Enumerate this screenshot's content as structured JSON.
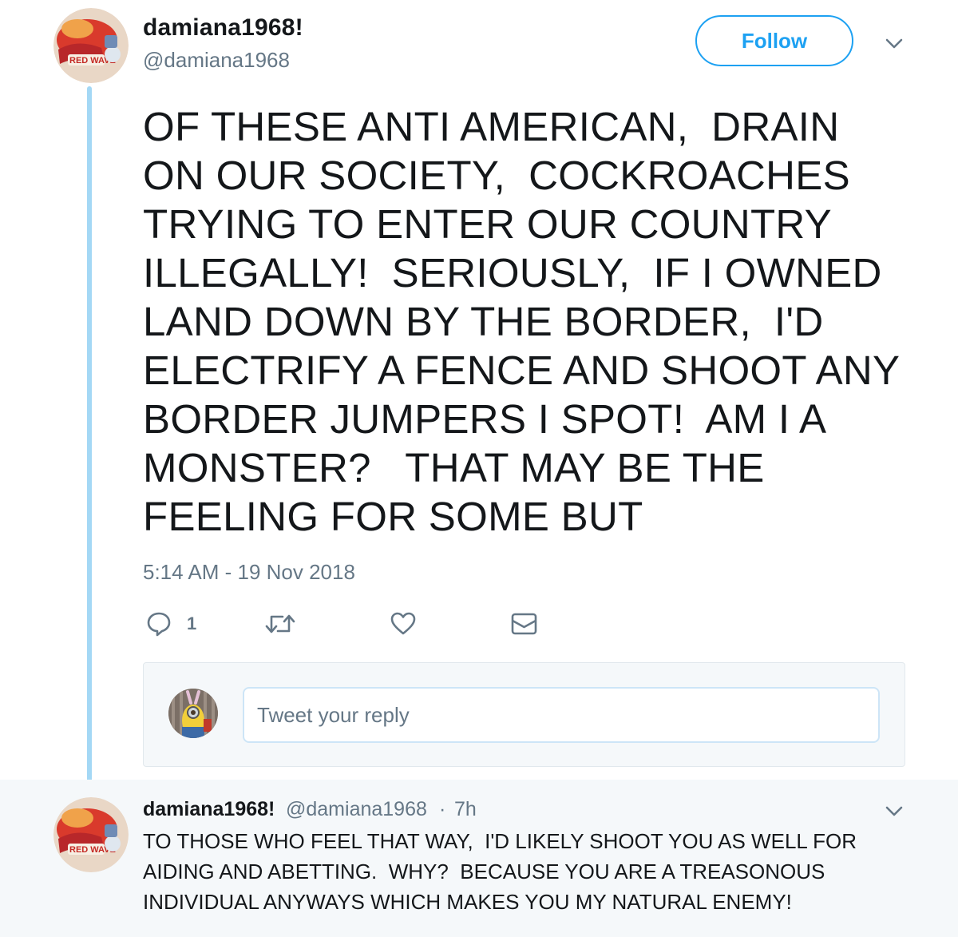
{
  "tweet": {
    "author": {
      "display_name": "damiana1968!",
      "handle": "@damiana1968",
      "avatar_icon": "avatar-red-wave-icon"
    },
    "follow_label": "Follow",
    "menu_icon": "chevron-down-icon",
    "text_lines": [
      "OF THESE ANTI AMERICAN,  DRAIN",
      "ON OUR SOCIETY,  COCKROACHES",
      "TRYING TO ENTER OUR COUNTRY",
      "ILLEGALLY!  SERIOUSLY,  IF I OWNED",
      "LAND DOWN BY THE BORDER,  I'D",
      "ELECTRIFY A FENCE AND SHOOT ANY",
      "BORDER JUMPERS I SPOT!  AM I A",
      "MONSTER?   THAT MAY BE THE",
      "FEELING FOR SOME BUT"
    ],
    "timestamp": "5:14 AM - 19 Nov 2018",
    "actions": {
      "reply_icon": "reply-icon",
      "reply_count": "1",
      "retweet_icon": "retweet-icon",
      "like_icon": "heart-icon",
      "dm_icon": "envelope-icon"
    }
  },
  "reply_composer": {
    "placeholder": "Tweet your reply",
    "user_avatar_icon": "avatar-minion-icon"
  },
  "reply": {
    "display_name": "damiana1968!",
    "handle": "@damiana1968",
    "separator": "·",
    "time": "7h",
    "menu_icon": "chevron-down-icon",
    "text_lines": [
      "TO THOSE WHO FEEL THAT WAY,  I'D LIKELY SHOOT YOU AS WELL FOR",
      "AIDING AND ABETTING.  WHY?  BECAUSE YOU ARE A TREASONOUS",
      "INDIVIDUAL ANYWAYS WHICH MAKES YOU MY NATURAL ENEMY!"
    ]
  },
  "colors": {
    "accent": "#1da1f2",
    "thread_line": "#a4d8f5",
    "secondary_text": "#657786",
    "reply_background": "#f5f8fa"
  }
}
